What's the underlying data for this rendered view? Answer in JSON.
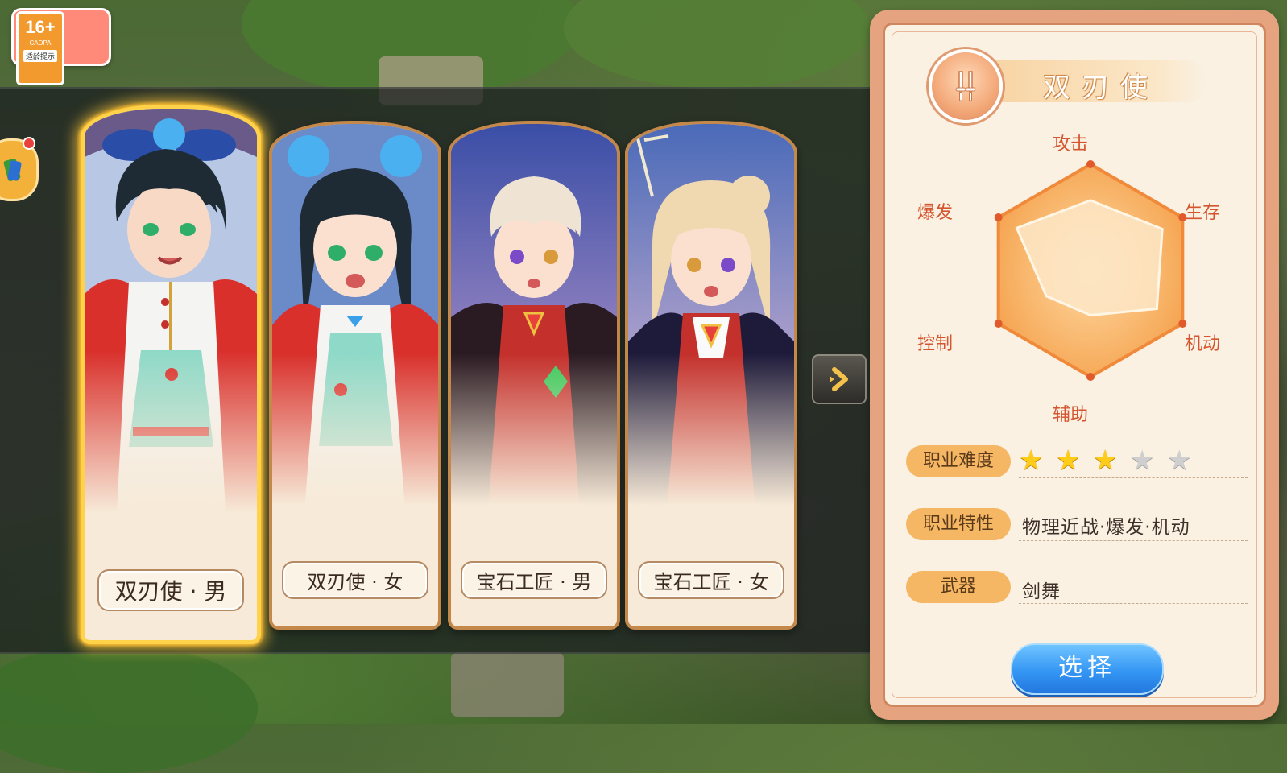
{
  "age_badge": {
    "rating": "16+",
    "org": "CADPA",
    "tip": "适龄提示"
  },
  "characters": [
    {
      "name": "双刃使 · 男",
      "selected": true
    },
    {
      "name": "双刃使 · 女",
      "selected": false
    },
    {
      "name": "宝石工匠 · 男",
      "selected": false
    },
    {
      "name": "宝石工匠 · 女",
      "selected": false
    }
  ],
  "panel": {
    "class_name": "双刃使",
    "emblem_icon": "dual-blade-icon",
    "stats": {
      "attack": "攻击",
      "survival": "生存",
      "mobility": "机动",
      "support": "辅助",
      "control": "控制",
      "burst": "爆发"
    },
    "radar_values": {
      "attack": 0.66,
      "survival": 0.78,
      "mobility": 0.72,
      "support": 0.42,
      "control": 0.48,
      "burst": 0.8
    },
    "difficulty_label": "职业难度",
    "difficulty_stars": 3,
    "difficulty_max": 5,
    "trait_label": "职业特性",
    "trait_value": "物理近战·爆发·机动",
    "weapon_label": "武器",
    "weapon_value": "剑舞",
    "select_label": "选择"
  },
  "colors": {
    "accent": "#f5b764",
    "selected_glow": "#ffd24a",
    "button": "#3496f4",
    "stat_text": "#d4552e"
  }
}
